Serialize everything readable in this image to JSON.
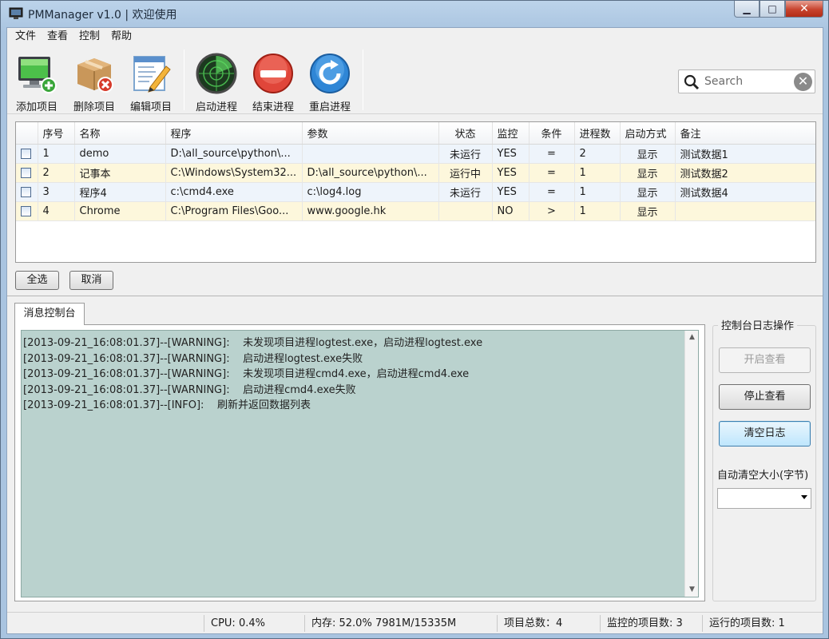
{
  "window": {
    "title": "PMManager v1.0 |  欢迎使用",
    "minimize": "▁",
    "maximize": "□",
    "close": "✕"
  },
  "menu": [
    "文件",
    "查看",
    "控制",
    "帮助"
  ],
  "toolbar": {
    "add": "添加项目",
    "delete": "删除项目",
    "edit": "编辑项目",
    "start": "启动进程",
    "stop": "结束进程",
    "restart": "重启进程"
  },
  "search": {
    "placeholder": "Search",
    "clear": "✕"
  },
  "grid": {
    "columns": [
      "",
      "序号",
      "名称",
      "程序",
      "参数",
      "状态",
      "监控",
      "条件",
      "进程数",
      "启动方式",
      "备注"
    ],
    "rows": [
      [
        "",
        "1",
        "demo",
        "D:\\all_source\\python\\...",
        "",
        "未运行",
        "YES",
        "=",
        "2",
        "显示",
        "测试数据1"
      ],
      [
        "",
        "2",
        "记事本",
        "C:\\Windows\\System32...",
        "D:\\all_source\\python\\...",
        "运行中",
        "YES",
        "=",
        "1",
        "显示",
        "测试数据2"
      ],
      [
        "",
        "3",
        "程序4",
        "c:\\cmd4.exe",
        "c:\\log4.log",
        "未运行",
        "YES",
        "=",
        "1",
        "显示",
        "测试数据4"
      ],
      [
        "",
        "4",
        "Chrome",
        "C:\\Program Files\\Goo...",
        "www.google.hk",
        "",
        "NO",
        ">",
        "1",
        "显示",
        ""
      ]
    ]
  },
  "buttons": {
    "select_all": "全选",
    "cancel": "取消"
  },
  "console": {
    "tab": "消息控制台",
    "lines": [
      "[2013-09-21_16:08:01.37]--[WARNING]:    未发现项目进程logtest.exe，启动进程logtest.exe",
      "[2013-09-21_16:08:01.37]--[WARNING]:    启动进程logtest.exe失败",
      "[2013-09-21_16:08:01.37]--[WARNING]:    未发现项目进程cmd4.exe，启动进程cmd4.exe",
      "[2013-09-21_16:08:01.37]--[WARNING]:    启动进程cmd4.exe失败",
      "[2013-09-21_16:08:01.37]--[INFO]:    刷新并返回数据列表"
    ]
  },
  "log_ops": {
    "title": "控制台日志操作",
    "open_view": "开启查看",
    "stop_view": "停止查看",
    "clear_log": "清空日志",
    "auto_clear_label": "自动清空大小(字节)",
    "auto_clear_value": ""
  },
  "status": {
    "cpu": "CPU: 0.4%",
    "memory": "内存:  52.0%  7981M/15335M",
    "total": "项目总数：4",
    "monitored": "监控的项目数: 3",
    "running": "运行的项目数: 1"
  }
}
